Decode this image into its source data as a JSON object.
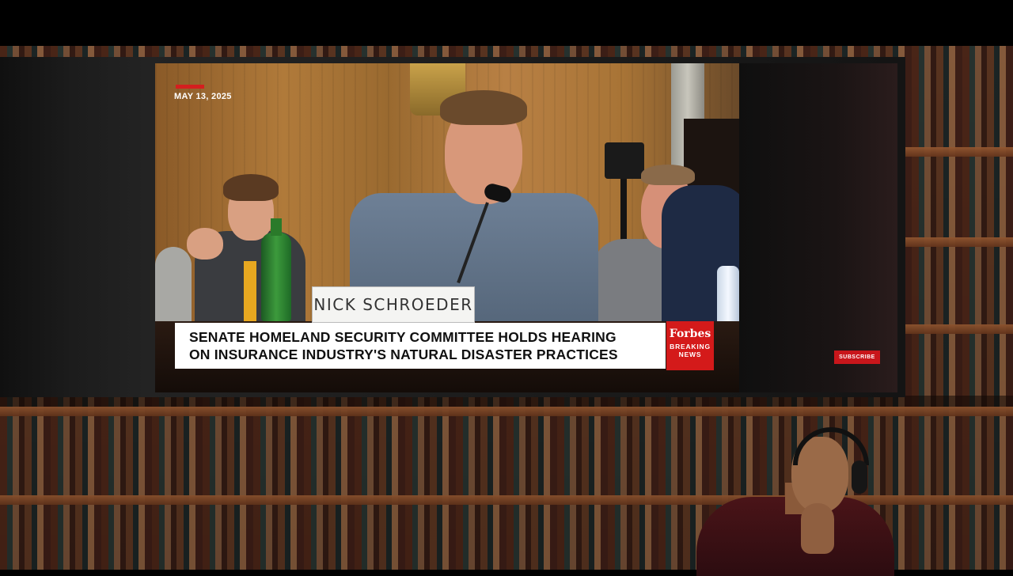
{
  "video": {
    "date": "MAY 13, 2025",
    "nameplate": "NICK SCHROEDER",
    "headline_line1": "SENATE HOMELAND SECURITY COMMITTEE HOLDS HEARING",
    "headline_line2": "ON INSURANCE INDUSTRY'S NATURAL DISASTER PRACTICES",
    "brand": "Forbes",
    "brand_sub_line1": "BREAKING",
    "brand_sub_line2": "NEWS",
    "accent_color": "#d41a1a"
  },
  "subscribe_label": "SUBSCRIBE"
}
